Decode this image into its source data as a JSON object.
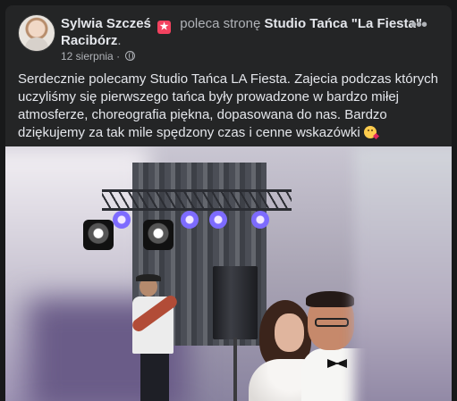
{
  "post": {
    "author": "Sylwia Szcześ",
    "action": "poleca stronę",
    "page_name": "Studio Tańca \"La Fiesta\"",
    "page_location": "Racibórz",
    "period": ".",
    "date": "12 sierpnia",
    "date_separator": "·",
    "more_label": "•••",
    "text": "Serdecznie polecamy Studio Tańca LA Fiesta. Zajecia podczas których uczyliśmy się pierwszego tańca były prowadzone w bardzo miłej atmosferze, choreografia piękna, dopasowana do nas. Bardzo dziękujemy za tak mile spędzony czas i cenne wskazówki"
  },
  "icons": {
    "recommend": "recommend-badge-icon",
    "privacy": "globe-icon",
    "more": "more-options-icon",
    "emoji": "face-blowing-kiss-icon"
  },
  "colors": {
    "background": "#18191a",
    "card": "#242526",
    "primary_text": "#e4e6eb",
    "secondary_text": "#b0b3b8",
    "recommend_badge": "#f3425f"
  }
}
